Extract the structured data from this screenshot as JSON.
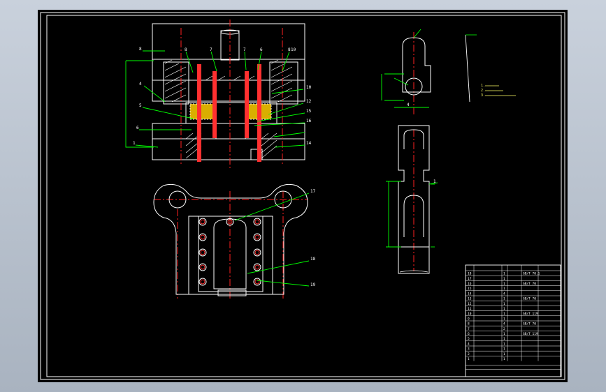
{
  "colors": {
    "background": "#000000",
    "outline": "#ffffff",
    "centerline": "#ff2020",
    "dimension": "#00ff00",
    "leader": "#00ff00",
    "hatch": "#ffffff",
    "section_fill": "#ff3030",
    "annotation": "#ffff66",
    "viewport_backdrop": "#b0b9c6"
  },
  "assembly": {
    "callouts_left": [
      "8",
      "4",
      "5",
      "6",
      "1"
    ],
    "callouts_top": [
      "8",
      "7",
      "7",
      "6",
      "8",
      "10"
    ],
    "callouts_right": [
      "10",
      "12",
      "15",
      "16",
      "14"
    ]
  },
  "plan_view": {
    "callouts": [
      "17",
      "18",
      "19"
    ]
  },
  "detail_top": {
    "notes": [
      "1.",
      "2.",
      "3."
    ],
    "dimension": "4"
  },
  "detail_mid": {
    "label": "1"
  },
  "title_block": {
    "rows": [
      {
        "no": "18",
        "name": "",
        "qty": "1",
        "mat": "",
        "note": "GB/T 70.1"
      },
      {
        "no": "17",
        "name": "",
        "qty": "1",
        "mat": "",
        "note": ""
      },
      {
        "no": "16",
        "name": "",
        "qty": "1",
        "mat": "",
        "note": "GB/T 70"
      },
      {
        "no": "15",
        "name": "",
        "qty": "1",
        "mat": "",
        "note": ""
      },
      {
        "no": "14",
        "name": "",
        "qty": "4",
        "mat": "",
        "note": ""
      },
      {
        "no": "13",
        "name": "",
        "qty": "1",
        "mat": "",
        "note": "GB/T 70"
      },
      {
        "no": "12",
        "name": "",
        "qty": "1",
        "mat": "",
        "note": ""
      },
      {
        "no": "11",
        "name": "",
        "qty": "1",
        "mat": "",
        "note": ""
      },
      {
        "no": "10",
        "name": "",
        "qty": "1",
        "mat": "",
        "note": "GB/T 119"
      },
      {
        "no": "9",
        "name": "",
        "qty": "1",
        "mat": "",
        "note": ""
      },
      {
        "no": "8",
        "name": "",
        "qty": "4",
        "mat": "",
        "note": "GB/T 70"
      },
      {
        "no": "7",
        "name": "",
        "qty": "2",
        "mat": "",
        "note": ""
      },
      {
        "no": "6",
        "name": "",
        "qty": "1",
        "mat": "",
        "note": "GB/T 119"
      },
      {
        "no": "5",
        "name": "",
        "qty": "1",
        "mat": "",
        "note": ""
      },
      {
        "no": "4",
        "name": "",
        "qty": "1",
        "mat": "",
        "note": ""
      },
      {
        "no": "3",
        "name": "",
        "qty": "1",
        "mat": "",
        "note": ""
      },
      {
        "no": "2",
        "name": "",
        "qty": "1",
        "mat": "",
        "note": ""
      },
      {
        "no": "1",
        "name": "",
        "qty": "1",
        "mat": "",
        "note": ""
      }
    ]
  }
}
